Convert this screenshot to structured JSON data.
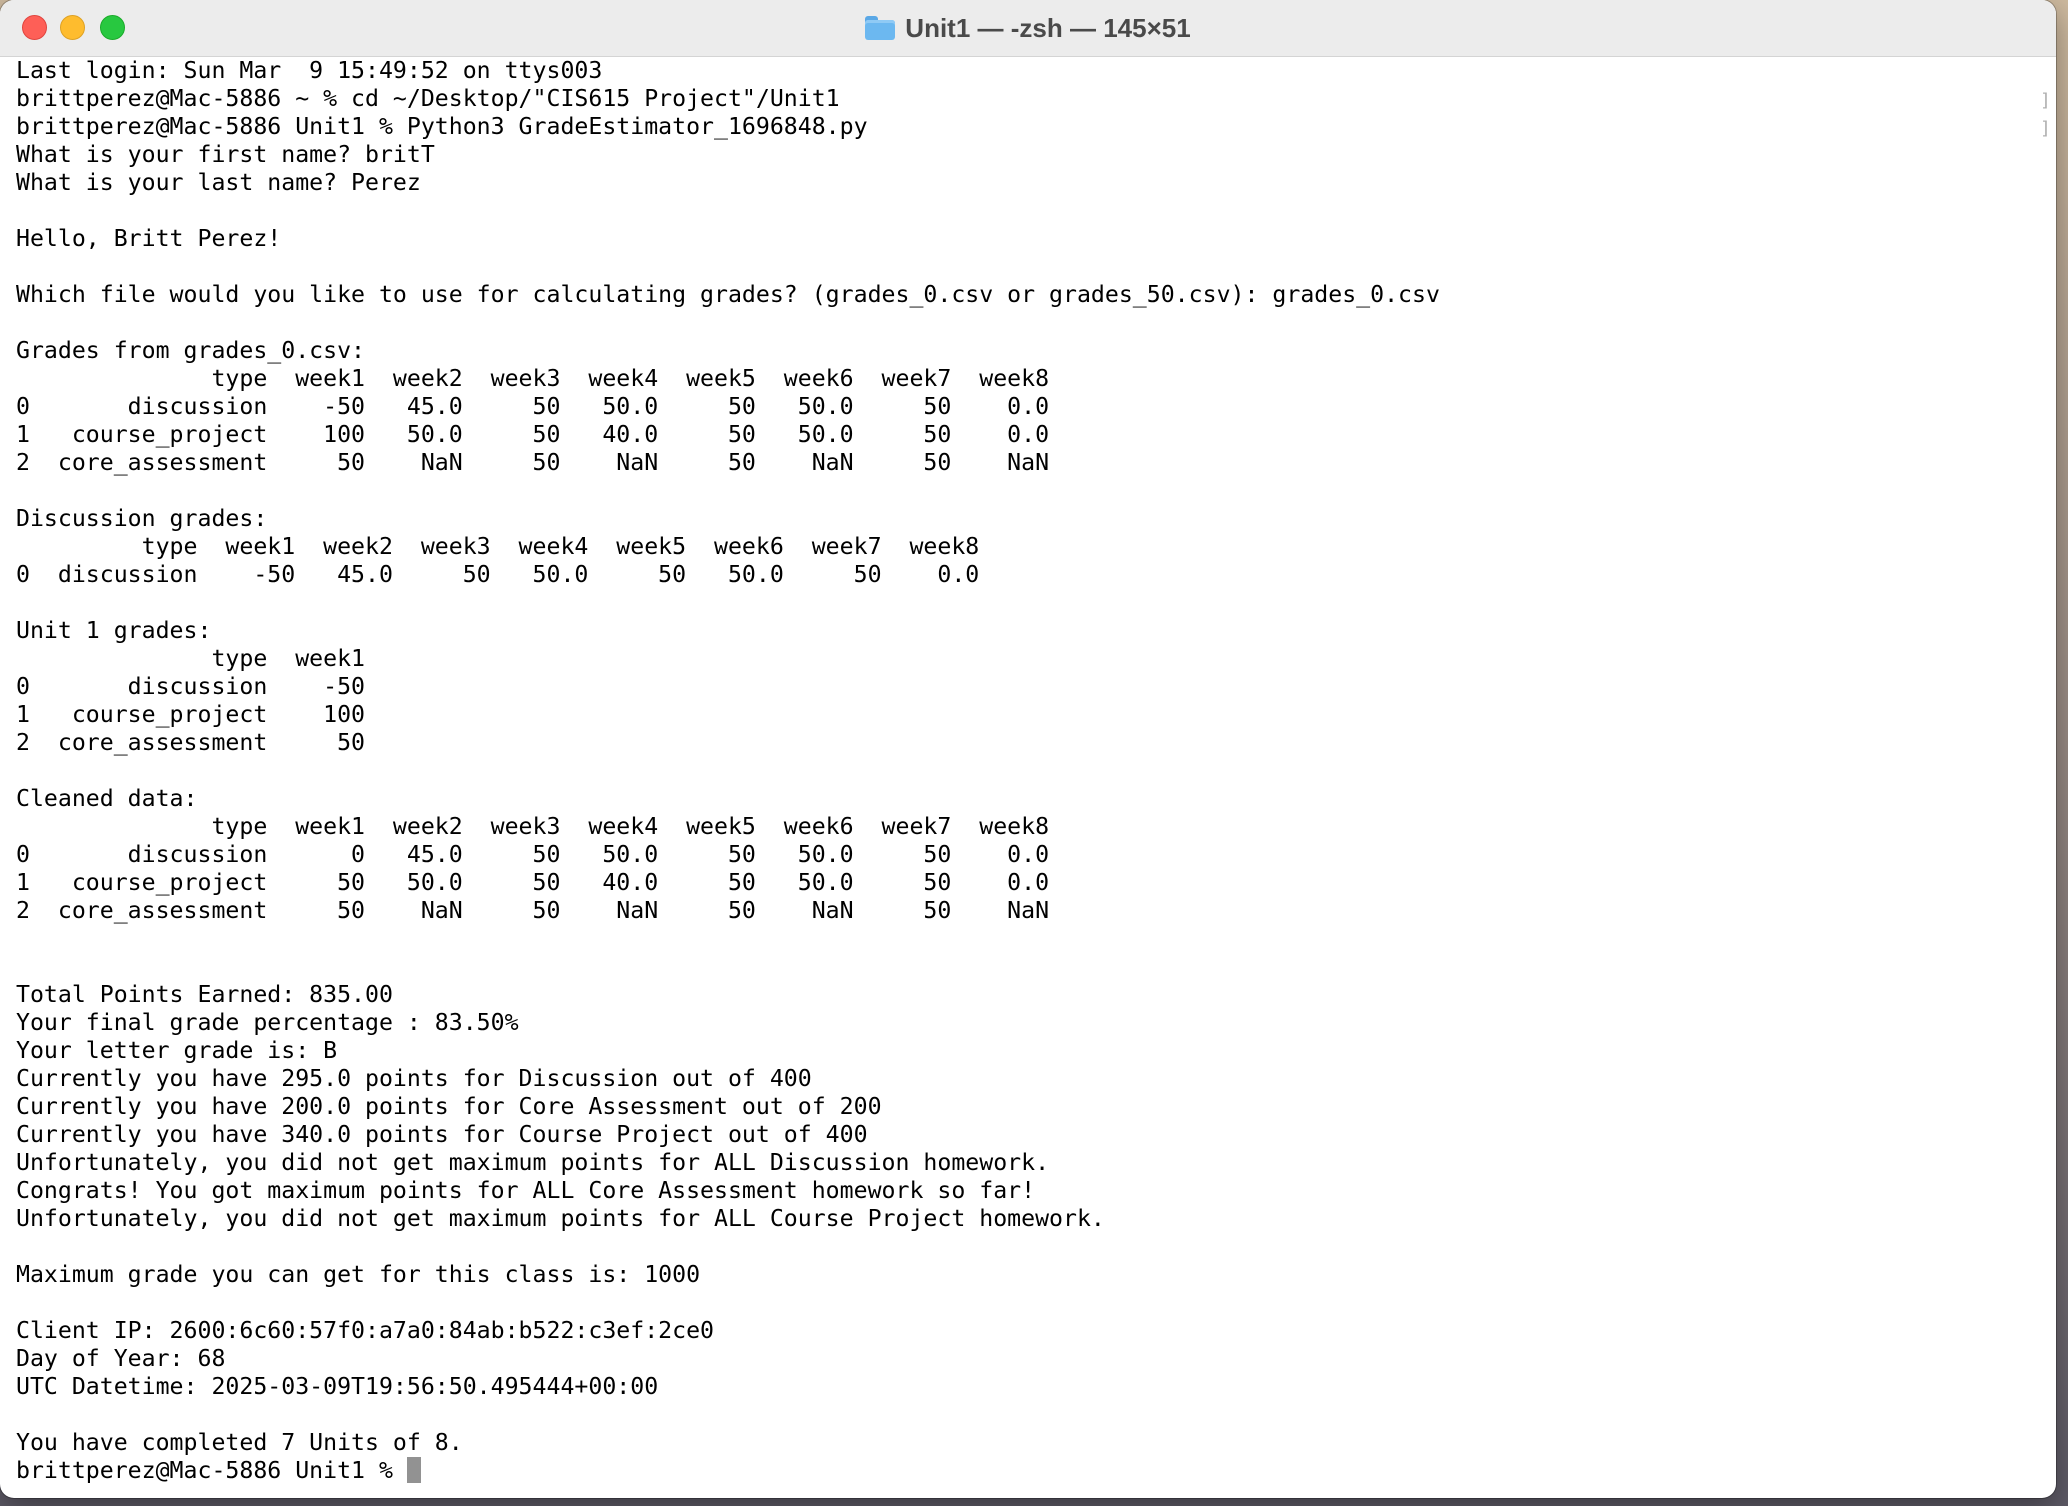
{
  "window": {
    "title": "Unit1 — -zsh — 145×51"
  },
  "terminal": {
    "lines": [
      "Last login: Sun Mar  9 15:49:52 on ttys003",
      "brittperez@Mac-5886 ~ % cd ~/Desktop/\"CIS615 Project\"/Unit1",
      "brittperez@Mac-5886 Unit1 % Python3 GradeEstimator_1696848.py",
      "What is your first name? britT",
      "What is your last name? Perez",
      "",
      "Hello, Britt Perez!",
      "",
      "Which file would you like to use for calculating grades? (grades_0.csv or grades_50.csv): grades_0.csv",
      "",
      "Grades from grades_0.csv:",
      "              type  week1  week2  week3  week4  week5  week6  week7  week8",
      "0       discussion    -50   45.0     50   50.0     50   50.0     50    0.0",
      "1   course_project    100   50.0     50   40.0     50   50.0     50    0.0",
      "2  core_assessment     50    NaN     50    NaN     50    NaN     50    NaN",
      "",
      "Discussion grades:",
      "         type  week1  week2  week3  week4  week5  week6  week7  week8",
      "0  discussion    -50   45.0     50   50.0     50   50.0     50    0.0",
      "",
      "Unit 1 grades:",
      "              type  week1",
      "0       discussion    -50",
      "1   course_project    100",
      "2  core_assessment     50",
      "",
      "Cleaned data:",
      "              type  week1  week2  week3  week4  week5  week6  week7  week8",
      "0       discussion      0   45.0     50   50.0     50   50.0     50    0.0",
      "1   course_project     50   50.0     50   40.0     50   50.0     50    0.0",
      "2  core_assessment     50    NaN     50    NaN     50    NaN     50    NaN",
      "",
      "",
      "Total Points Earned: 835.00",
      "Your final grade percentage : 83.50%",
      "Your letter grade is: B",
      "Currently you have 295.0 points for Discussion out of 400",
      "Currently you have 200.0 points for Core Assessment out of 200",
      "Currently you have 340.0 points for Course Project out of 400",
      "Unfortunately, you did not get maximum points for ALL Discussion homework.",
      "Congrats! You got maximum points for ALL Core Assessment homework so far!",
      "Unfortunately, you did not get maximum points for ALL Course Project homework.",
      "",
      "Maximum grade you can get for this class is: 1000",
      "",
      "Client IP: 2600:6c60:57f0:a7a0:84ab:b522:c3ef:2ce0",
      "Day of Year: 68",
      "UTC Datetime: 2025-03-09T19:56:50.495444+00:00",
      "",
      "You have completed 7 Units of 8."
    ],
    "prompt": "brittperez@Mac-5886 Unit1 % "
  }
}
